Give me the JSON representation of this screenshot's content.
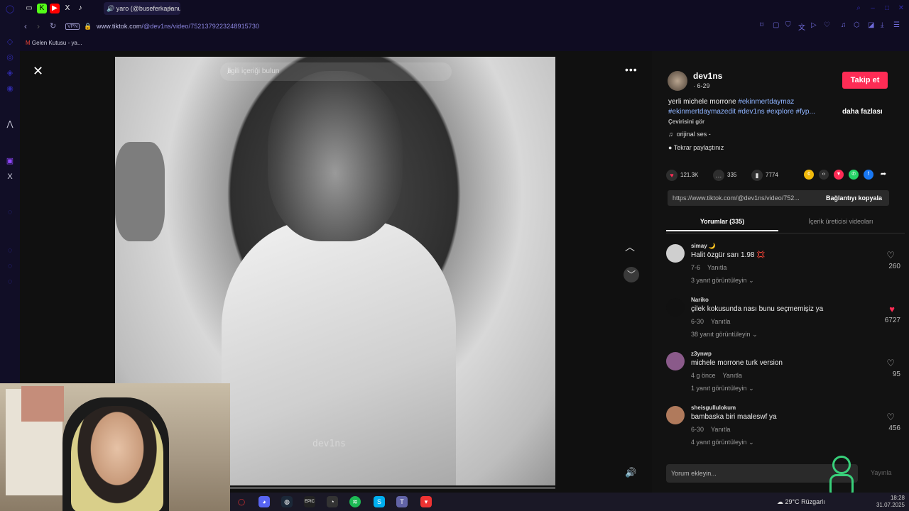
{
  "browser": {
    "tabs": [
      {
        "label": "yaro (@buseferkapanu",
        "active": true
      }
    ],
    "address": {
      "vpn": "VPN",
      "url_host": "www.tiktok.com",
      "url_path": "/@dev1ns/video/7521379223248915730"
    },
    "bookmarks": [
      "Gelen Kutusu - ya..."
    ]
  },
  "video_viewer": {
    "search_placeholder": "İlgili içeriği bulun",
    "watermark": "dev1ns",
    "progress": 0.0
  },
  "sidebar": {
    "author": {
      "name": "dev1ns",
      "meta": "· 6-29",
      "follow_label": "Takip et"
    },
    "caption": {
      "line1_text": "yerli michele morrone ",
      "line1_tag": "#ekinmertdaymaz",
      "line2_tags": "#ekinmertdaymazedit #dev1ns #explore #fyp...",
      "more": "daha fazlası",
      "translate": "Çevirisini gör"
    },
    "sound": "orijinal ses -",
    "reposted": "Tekrar paylaştınız",
    "stats": {
      "likes": "121.3K",
      "comments": "335",
      "saves": "7774"
    },
    "share_icons": [
      "coin-icon",
      "embed-icon",
      "send-icon",
      "whatsapp-icon",
      "facebook-icon",
      "share-arrow-icon"
    ],
    "link": {
      "url": "https://www.tiktok.com/@dev1ns/video/752...",
      "copy_label": "Bağlantıyı kopyala"
    },
    "tabs": {
      "comments": "Yorumlar (335)",
      "creator_videos": "İçerik üreticisi videoları"
    },
    "comments": [
      {
        "user": "simay 🌙",
        "text": "Halit özgür sarı 1.98 💢",
        "date": "7-6",
        "reply": "Yanıtla",
        "replies": "3 yanıt görüntüleyin",
        "likes": "260",
        "liked": false
      },
      {
        "user": "Nariko",
        "text": "çilek kokusunda nası bunu seçmemişiz ya",
        "date": "6-30",
        "reply": "Yanıtla",
        "replies": "38 yanıt görüntüleyin",
        "likes": "6727",
        "liked": true
      },
      {
        "user": "z3ynwp",
        "text": "michele morrone turk version",
        "date": "4 g önce",
        "reply": "Yanıtla",
        "replies": "1 yanıt görüntüleyin",
        "likes": "95",
        "liked": false
      },
      {
        "user": "sheisgullulokum",
        "text": "bambaska biri maaleswf ya",
        "date": "6-30",
        "reply": "Yanıtla",
        "replies": "4 yanıt görüntüleyin",
        "likes": "456",
        "liked": false
      }
    ],
    "add_comment_placeholder": "Yorum ekleyin...",
    "post_label": "Yayınla"
  },
  "taskbar": {
    "weather": "29°C  Rüzgarlı",
    "time": "18:28",
    "date": "31.07.2025"
  }
}
